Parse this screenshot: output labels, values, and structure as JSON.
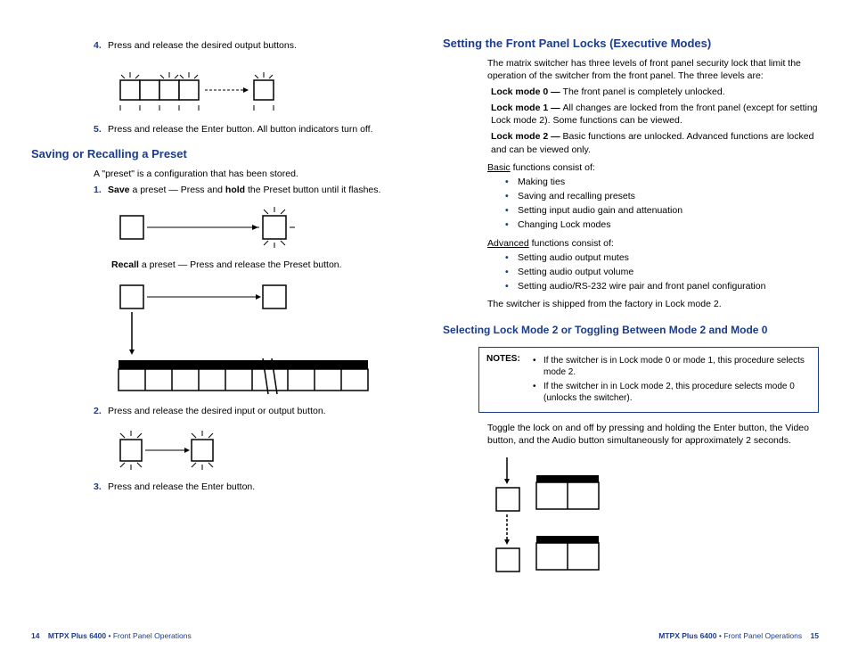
{
  "left": {
    "step4": {
      "num": "4.",
      "text": "Press and release the desired output buttons."
    },
    "step5": {
      "num": "5.",
      "text": "Press and release the Enter button. All button indicators turn off."
    },
    "h_saving": "Saving or Recalling a Preset",
    "preset_intro": "A \"preset\" is a configuration that has been stored.",
    "step1": {
      "num": "1.",
      "save": "Save",
      "rest": " a preset — Press and ",
      "hold": "hold",
      "rest2": " the Preset button until it flashes."
    },
    "recall_line": {
      "recall": "Recall",
      "rest": " a preset — Press and release the Preset button."
    },
    "step2": {
      "num": "2.",
      "text": "Press and release the desired input or output button."
    },
    "step3": {
      "num": "3.",
      "text": "Press and release the Enter button."
    }
  },
  "right": {
    "h_locks": "Setting the Front Panel Locks (Executive Modes)",
    "intro": "The matrix switcher has three levels of front panel security lock that limit the operation of the switcher from the front panel.  The three levels are:",
    "mode0": {
      "label": "Lock mode 0 — ",
      "text": "The front panel is completely unlocked."
    },
    "mode1": {
      "label": "Lock mode 1 — ",
      "text": "All changes are locked from the front panel (except for setting Lock mode 2).  Some functions can be viewed."
    },
    "mode2": {
      "label": "Lock mode 2 — ",
      "text": "Basic functions are unlocked.  Advanced functions are locked and can be viewed only."
    },
    "basic_label_u": "Basic",
    "basic_label_rest": " functions consist of:",
    "basic_items": [
      "Making ties",
      "Saving and recalling presets",
      "Setting input audio gain and attenuation",
      "Changing Lock modes"
    ],
    "adv_label_u": "Advanced",
    "adv_label_rest": " functions consist of:",
    "adv_items": [
      "Setting audio output mutes",
      "Setting audio output volume",
      "Setting audio/RS-232 wire pair and front panel configuration"
    ],
    "shipped": "The switcher is shipped from the factory in Lock mode 2.",
    "h_select": "Selecting Lock Mode 2 or Toggling Between Mode 2 and Mode 0",
    "notes_label": "NOTES:",
    "note1": "If the switcher is in Lock mode 0 or mode 1, this procedure selects mode 2.",
    "note2": "If the switcher in in Lock mode 2, this procedure selects mode 0 (unlocks the switcher).",
    "toggle": "Toggle the lock on and off by pressing and holding the Enter button, the Video button, and the Audio button simultaneously for approximately 2 seconds."
  },
  "footer": {
    "left_page": "14",
    "right_page": "15",
    "product": "MTPX Plus 6400",
    "section": "Front Panel Operations"
  }
}
